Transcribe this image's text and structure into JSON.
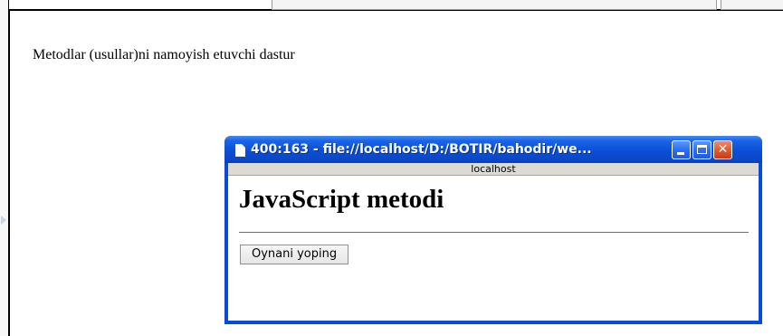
{
  "page": {
    "body_text": "Metodlar (usullar)ni namoyish etuvchi dastur"
  },
  "popup": {
    "title": "400:163 - file://localhost/D:/BOTIR/bahodir/we...",
    "status_host": "localhost",
    "heading": "JavaScript metodi",
    "close_button_label": "Oynani yoping",
    "icons": {
      "title_icon": "document-icon",
      "minimize": "minimize-icon",
      "maximize": "maximize-icon",
      "close": "close-icon"
    },
    "colors": {
      "titlebar": "#0a4fd7",
      "close_button": "#e35b33",
      "frame": "#0a4ad8"
    }
  }
}
